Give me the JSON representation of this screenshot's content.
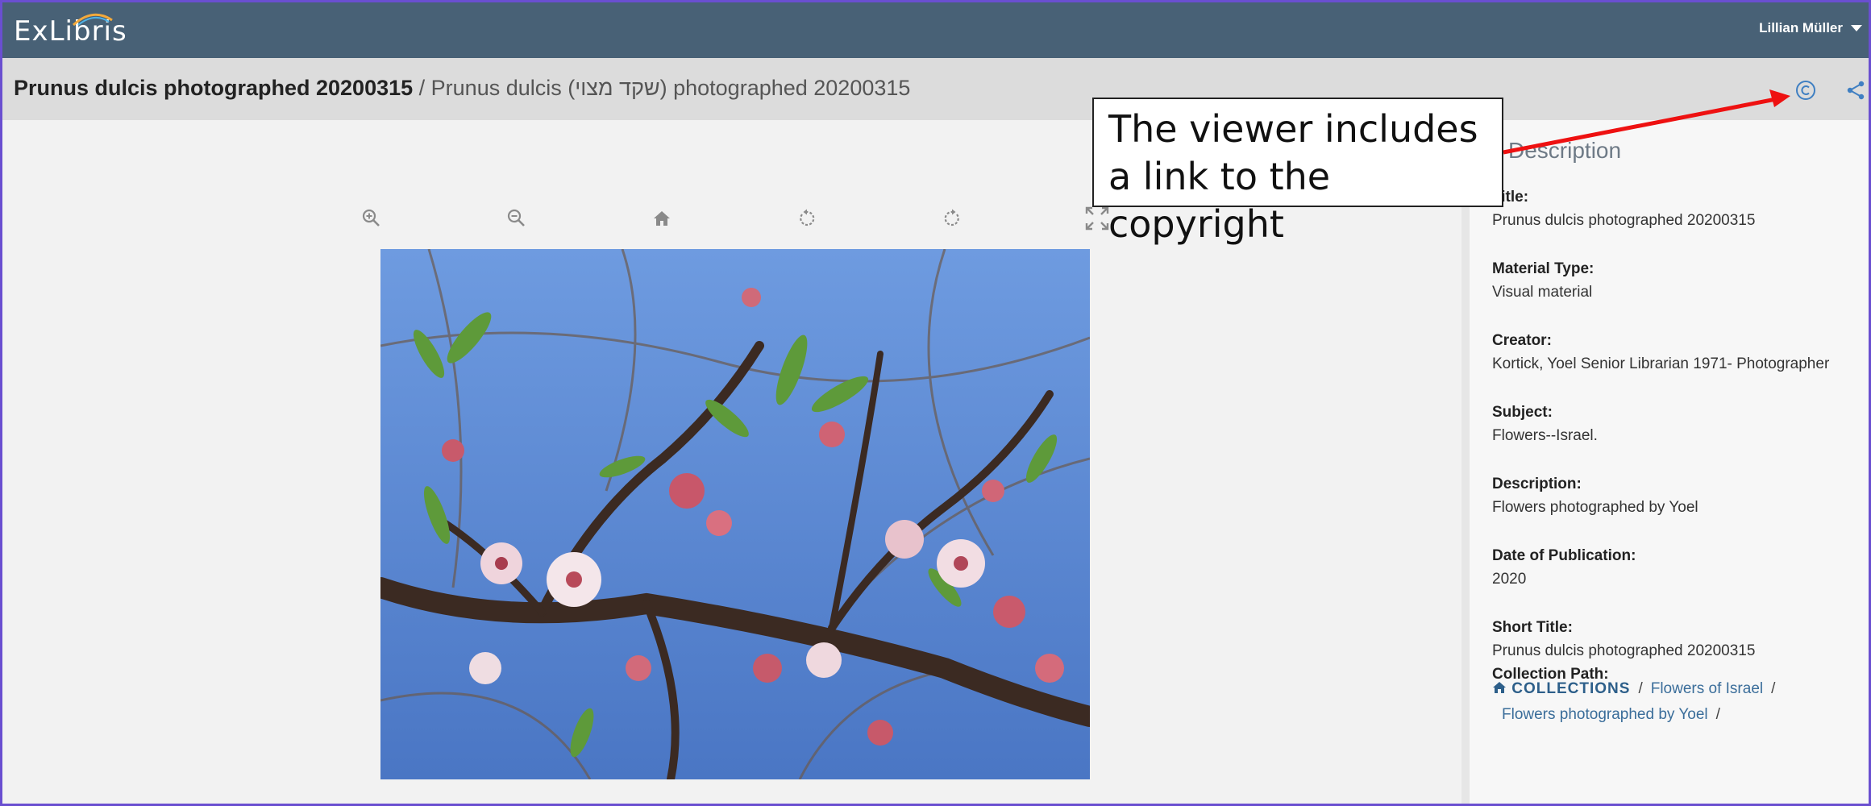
{
  "app": {
    "logo_text": "ExLibris",
    "user_name": "Lillian Müller"
  },
  "title_bar": {
    "main_title": "Prunus dulcis photographed 20200315",
    "separator": " / ",
    "alt_title": "Prunus dulcis (שקד מצוי) photographed 20200315"
  },
  "title_icons": [
    "copyright-icon",
    "share-icon"
  ],
  "viewer": {
    "toolbar": [
      "zoom-in-icon",
      "zoom-out-icon",
      "home-icon",
      "rotate-left-icon",
      "rotate-right-icon",
      "fullscreen-icon"
    ],
    "image_subject": "Almond blossoms on branches against blue sky"
  },
  "details": {
    "heading": "Description",
    "fields": [
      {
        "label": "Title:",
        "value": "Prunus dulcis photographed 20200315"
      },
      {
        "label": "Material Type:",
        "value": "Visual material"
      },
      {
        "label": "Creator:",
        "value": "Kortick, Yoel Senior Librarian 1971- Photographer"
      },
      {
        "label": "Subject:",
        "value": "Flowers--Israel."
      },
      {
        "label": "Description:",
        "value": "Flowers photographed by Yoel"
      },
      {
        "label": "Date of Publication:",
        "value": "2020"
      },
      {
        "label": "Short Title:",
        "value": "Prunus dulcis photographed 20200315"
      }
    ],
    "collection_path": {
      "label": "Collection Path:",
      "home": "COLLECTIONS",
      "items": [
        "Flowers of Israel",
        "Flowers photographed by Yoel"
      ],
      "separator": "/"
    }
  },
  "annotation": {
    "text": "The viewer includes a link to the copyright"
  },
  "colors": {
    "topbar": "#486176",
    "title_bar": "#dcdcdc",
    "accent_icon": "#3f7fc2",
    "link": "#3a6d9a",
    "arrow": "#ee1111",
    "frame": "#6a4fd0"
  }
}
